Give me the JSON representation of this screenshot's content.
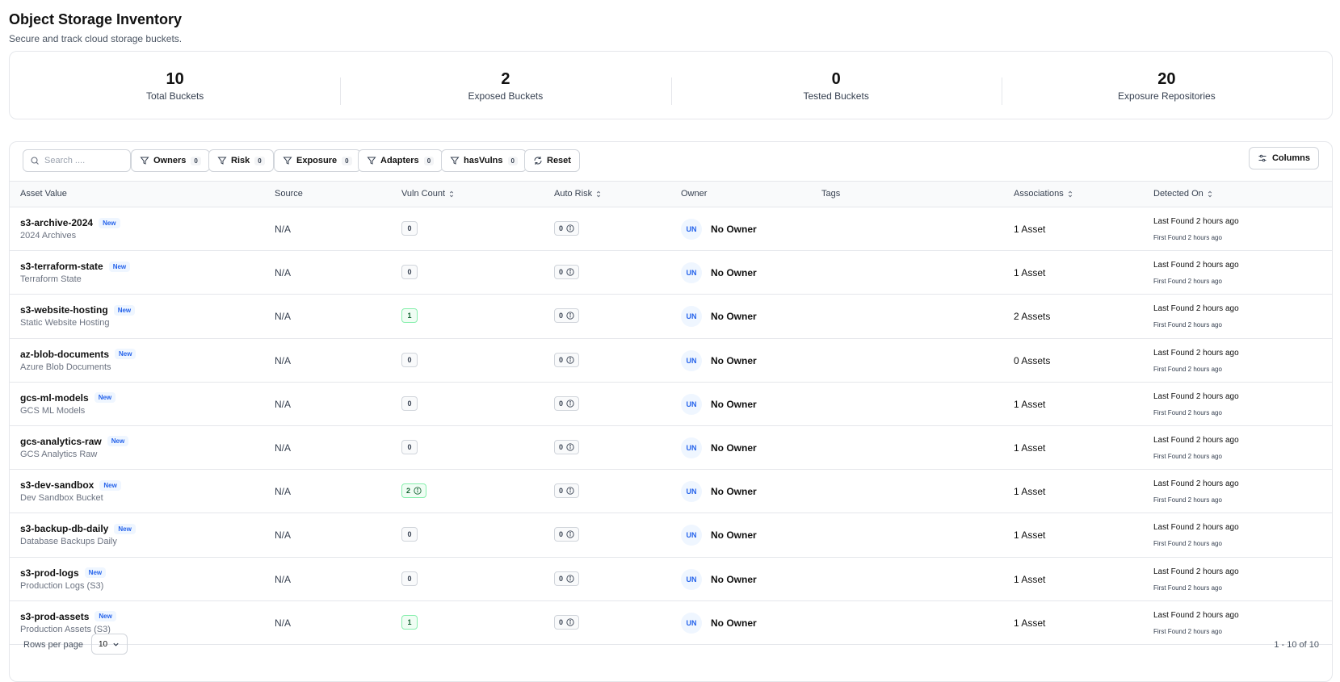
{
  "header": {
    "title": "Object Storage Inventory",
    "subtitle": "Secure and track cloud storage buckets."
  },
  "stats": [
    {
      "value": "10",
      "label": "Total Buckets"
    },
    {
      "value": "2",
      "label": "Exposed Buckets"
    },
    {
      "value": "0",
      "label": "Tested Buckets"
    },
    {
      "value": "20",
      "label": "Exposure Repositories"
    }
  ],
  "toolbar": {
    "search_placeholder": "Search ....",
    "filters": [
      {
        "label": "Owners",
        "count": "0"
      },
      {
        "label": "Risk",
        "count": "0"
      },
      {
        "label": "Exposure",
        "count": "0"
      },
      {
        "label": "Adapters",
        "count": "0"
      },
      {
        "label": "hasVulns",
        "count": "0"
      }
    ],
    "reset_label": "Reset",
    "columns_label": "Columns"
  },
  "columns": {
    "asset_value": "Asset Value",
    "source": "Source",
    "vuln_count": "Vuln Count",
    "auto_risk": "Auto Risk",
    "owner": "Owner",
    "tags": "Tags",
    "associations": "Associations",
    "detected_on": "Detected On"
  },
  "rows": [
    {
      "name": "s3-archive-2024",
      "badge": "New",
      "desc": "2024 Archives",
      "source": "N/A",
      "vuln": "0",
      "vuln_green": false,
      "vuln_info": false,
      "risk": "0",
      "owner_initials": "UN",
      "owner": "No Owner",
      "assoc": "1 Asset",
      "last": "Last Found 2 hours ago",
      "first": "First Found 2 hours ago"
    },
    {
      "name": "s3-terraform-state",
      "badge": "New",
      "desc": "Terraform State",
      "source": "N/A",
      "vuln": "0",
      "vuln_green": false,
      "vuln_info": false,
      "risk": "0",
      "owner_initials": "UN",
      "owner": "No Owner",
      "assoc": "1 Asset",
      "last": "Last Found 2 hours ago",
      "first": "First Found 2 hours ago"
    },
    {
      "name": "s3-website-hosting",
      "badge": "New",
      "desc": "Static Website Hosting",
      "source": "N/A",
      "vuln": "1",
      "vuln_green": true,
      "vuln_info": false,
      "risk": "0",
      "owner_initials": "UN",
      "owner": "No Owner",
      "assoc": "2 Assets",
      "last": "Last Found 2 hours ago",
      "first": "First Found 2 hours ago"
    },
    {
      "name": "az-blob-documents",
      "badge": "New",
      "desc": "Azure Blob Documents",
      "source": "N/A",
      "vuln": "0",
      "vuln_green": false,
      "vuln_info": false,
      "risk": "0",
      "owner_initials": "UN",
      "owner": "No Owner",
      "assoc": "0 Assets",
      "last": "Last Found 2 hours ago",
      "first": "First Found 2 hours ago"
    },
    {
      "name": "gcs-ml-models",
      "badge": "New",
      "desc": "GCS ML Models",
      "source": "N/A",
      "vuln": "0",
      "vuln_green": false,
      "vuln_info": false,
      "risk": "0",
      "owner_initials": "UN",
      "owner": "No Owner",
      "assoc": "1 Asset",
      "last": "Last Found 2 hours ago",
      "first": "First Found 2 hours ago"
    },
    {
      "name": "gcs-analytics-raw",
      "badge": "New",
      "desc": "GCS Analytics Raw",
      "source": "N/A",
      "vuln": "0",
      "vuln_green": false,
      "vuln_info": false,
      "risk": "0",
      "owner_initials": "UN",
      "owner": "No Owner",
      "assoc": "1 Asset",
      "last": "Last Found 2 hours ago",
      "first": "First Found 2 hours ago"
    },
    {
      "name": "s3-dev-sandbox",
      "badge": "New",
      "desc": "Dev Sandbox Bucket",
      "source": "N/A",
      "vuln": "2",
      "vuln_green": true,
      "vuln_info": true,
      "risk": "0",
      "owner_initials": "UN",
      "owner": "No Owner",
      "assoc": "1 Asset",
      "last": "Last Found 2 hours ago",
      "first": "First Found 2 hours ago"
    },
    {
      "name": "s3-backup-db-daily",
      "badge": "New",
      "desc": "Database Backups Daily",
      "source": "N/A",
      "vuln": "0",
      "vuln_green": false,
      "vuln_info": false,
      "risk": "0",
      "owner_initials": "UN",
      "owner": "No Owner",
      "assoc": "1 Asset",
      "last": "Last Found 2 hours ago",
      "first": "First Found 2 hours ago"
    },
    {
      "name": "s3-prod-logs",
      "badge": "New",
      "desc": "Production Logs (S3)",
      "source": "N/A",
      "vuln": "0",
      "vuln_green": false,
      "vuln_info": false,
      "risk": "0",
      "owner_initials": "UN",
      "owner": "No Owner",
      "assoc": "1 Asset",
      "last": "Last Found 2 hours ago",
      "first": "First Found 2 hours ago"
    },
    {
      "name": "s3-prod-assets",
      "badge": "New",
      "desc": "Production Assets (S3)",
      "source": "N/A",
      "vuln": "1",
      "vuln_green": true,
      "vuln_info": false,
      "risk": "0",
      "owner_initials": "UN",
      "owner": "No Owner",
      "assoc": "1 Asset",
      "last": "Last Found 2 hours ago",
      "first": "First Found 2 hours ago"
    }
  ],
  "footer": {
    "rows_per_page_label": "Rows per page",
    "rows_per_page_value": "10",
    "page_info": "1 - 10 of 10"
  }
}
